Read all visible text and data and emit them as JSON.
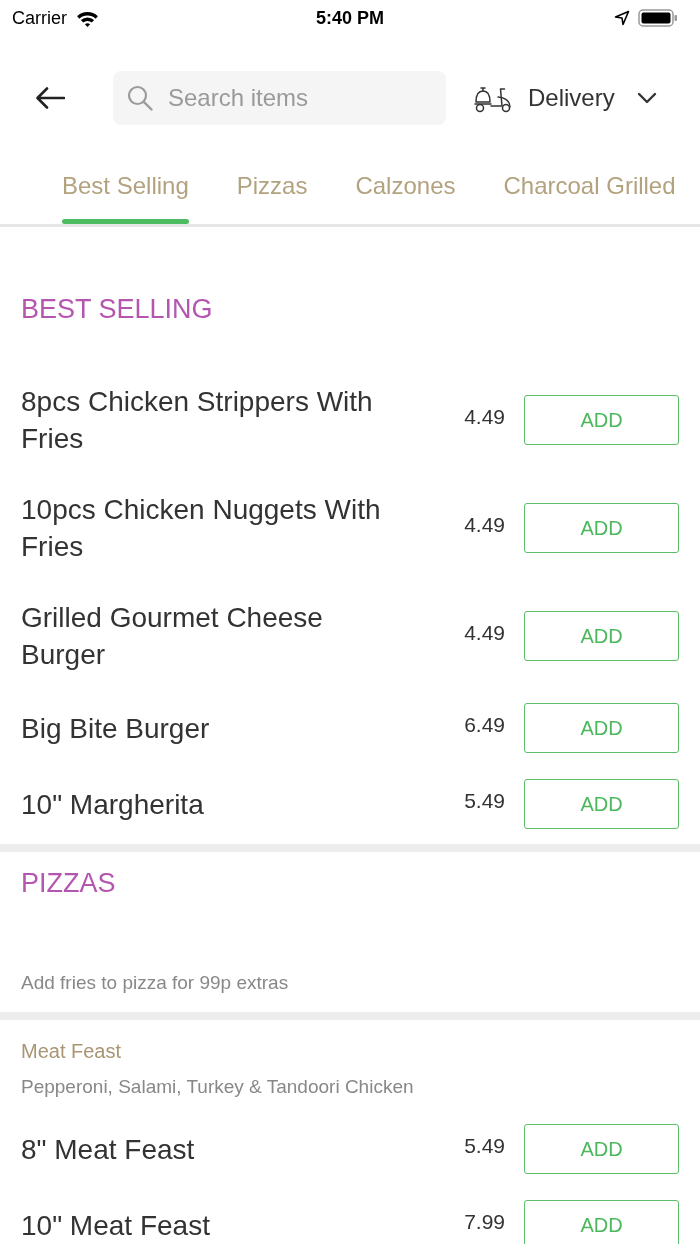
{
  "status_bar": {
    "carrier": "Carrier",
    "time": "5:40 PM"
  },
  "header": {
    "search": {
      "placeholder": "Search items"
    },
    "order_mode": {
      "label": "Delivery"
    }
  },
  "tabs": [
    {
      "label": "Best Selling",
      "selected": true
    },
    {
      "label": "Pizzas",
      "selected": false
    },
    {
      "label": "Calzones",
      "selected": false
    },
    {
      "label": "Charcoal Grilled",
      "selected": false
    }
  ],
  "sections": [
    {
      "title": "BEST SELLING",
      "items": [
        {
          "name": "8pcs Chicken Strippers With Fries",
          "price": "4.49",
          "button": "ADD"
        },
        {
          "name": "10pcs Chicken Nuggets With Fries",
          "price": "4.49",
          "button": "ADD"
        },
        {
          "name": "Grilled Gourmet Cheese Burger",
          "price": "4.49",
          "button": "ADD"
        },
        {
          "name": "Big Bite Burger",
          "price": "6.49",
          "button": "ADD"
        },
        {
          "name": "10\" Margherita",
          "price": "5.49",
          "button": "ADD"
        }
      ]
    },
    {
      "title": "PIZZAS",
      "note": "Add fries to pizza for 99p extras",
      "groups": [
        {
          "title": "Meat Feast",
          "description": "Pepperoni, Salami, Turkey & Tandoori Chicken",
          "items": [
            {
              "name": "8\" Meat Feast",
              "price": "5.49",
              "button": "ADD"
            },
            {
              "name": "10\" Meat Feast",
              "price": "7.99",
              "button": "ADD"
            }
          ]
        }
      ]
    }
  ]
}
